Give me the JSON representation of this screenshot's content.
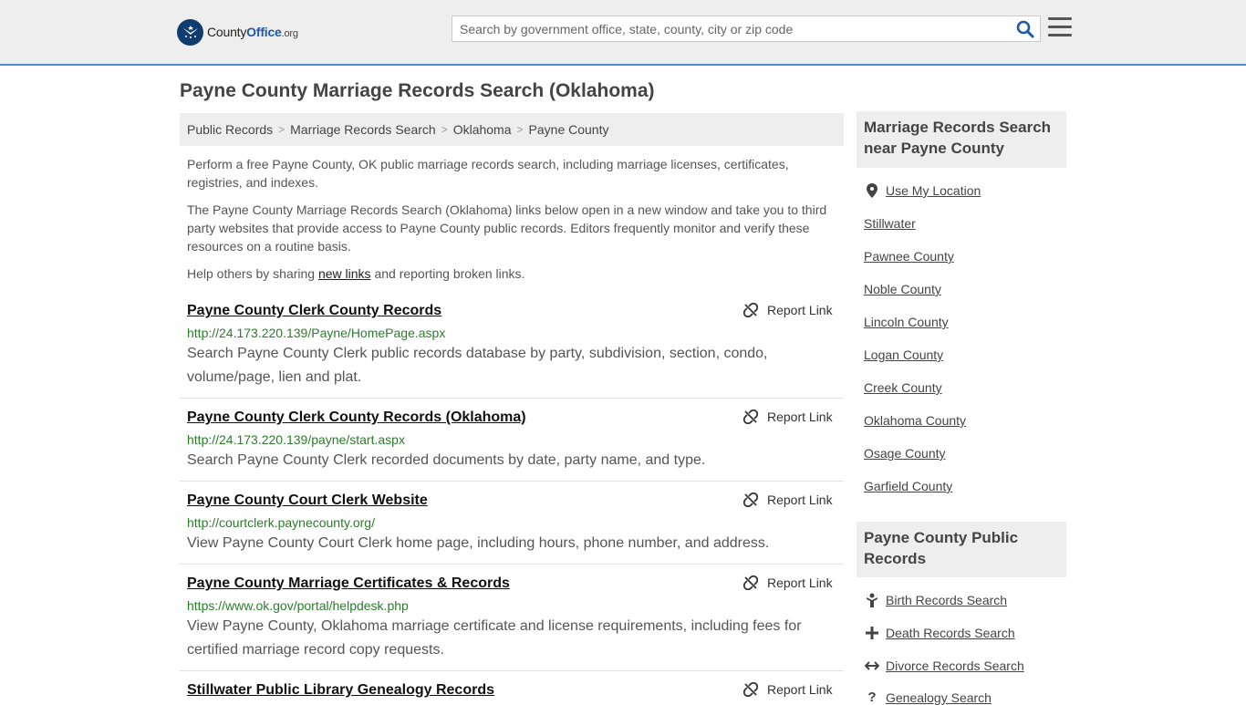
{
  "header": {
    "logo_text_main": "County",
    "logo_text_accent": "Office",
    "logo_text_suffix": ".org",
    "search_placeholder": "Search by government office, state, county, city or zip code"
  },
  "page_title": "Payne County Marriage Records Search (Oklahoma)",
  "breadcrumb": [
    "Public Records",
    "Marriage Records Search",
    "Oklahoma",
    "Payne County"
  ],
  "intro": {
    "p1": "Perform a free Payne County, OK public marriage records search, including marriage licenses, certificates, registries, and indexes.",
    "p2": "The Payne County Marriage Records Search (Oklahoma) links below open in a new window and take you to third party websites that provide access to Payne County public records. Editors frequently monitor and verify these resources on a routine basis.",
    "p3_before": "Help others by sharing ",
    "p3_link": "new links",
    "p3_after": " and reporting broken links."
  },
  "report_label": "Report Link",
  "records": [
    {
      "title": "Payne County Clerk County Records",
      "url": "http://24.173.220.139/Payne/HomePage.aspx",
      "desc": "Search Payne County Clerk public records database by party, subdivision, section, condo, volume/page, lien and plat."
    },
    {
      "title": "Payne County Clerk County Records (Oklahoma)",
      "url": "http://24.173.220.139/payne/start.aspx",
      "desc": "Search Payne County Clerk recorded documents by date, party name, and type."
    },
    {
      "title": "Payne County Court Clerk Website",
      "url": "http://courtclerk.paynecounty.org/",
      "desc": "View Payne County Court Clerk home page, including hours, phone number, and address."
    },
    {
      "title": "Payne County Marriage Certificates & Records",
      "url": "https://www.ok.gov/portal/helpdesk.php",
      "desc": "View Payne County, Oklahoma marriage certificate and license requirements, including fees for certified marriage record copy requests."
    },
    {
      "title": "Stillwater Public Library Genealogy Records",
      "url": "",
      "desc": ""
    }
  ],
  "sidebar": {
    "nearby_heading": "Marriage Records Search near Payne County",
    "use_location": "Use My Location",
    "nearby_links": [
      "Stillwater",
      "Pawnee County",
      "Noble County",
      "Lincoln County",
      "Logan County",
      "Creek County",
      "Oklahoma County",
      "Osage County",
      "Garfield County"
    ],
    "public_heading": "Payne County Public Records",
    "public_links": [
      {
        "label": "Birth Records Search",
        "icon": "baby-icon"
      },
      {
        "label": "Death Records Search",
        "icon": "cross-icon"
      },
      {
        "label": "Divorce Records Search",
        "icon": "split-arrows-icon"
      },
      {
        "label": "Genealogy Search",
        "icon": "question-icon"
      }
    ]
  },
  "colors": {
    "header_bg": "#eeeeee",
    "header_border": "#4a8ccb",
    "url_green": "#2a7d2a",
    "brand_blue": "#1e5aa8"
  }
}
